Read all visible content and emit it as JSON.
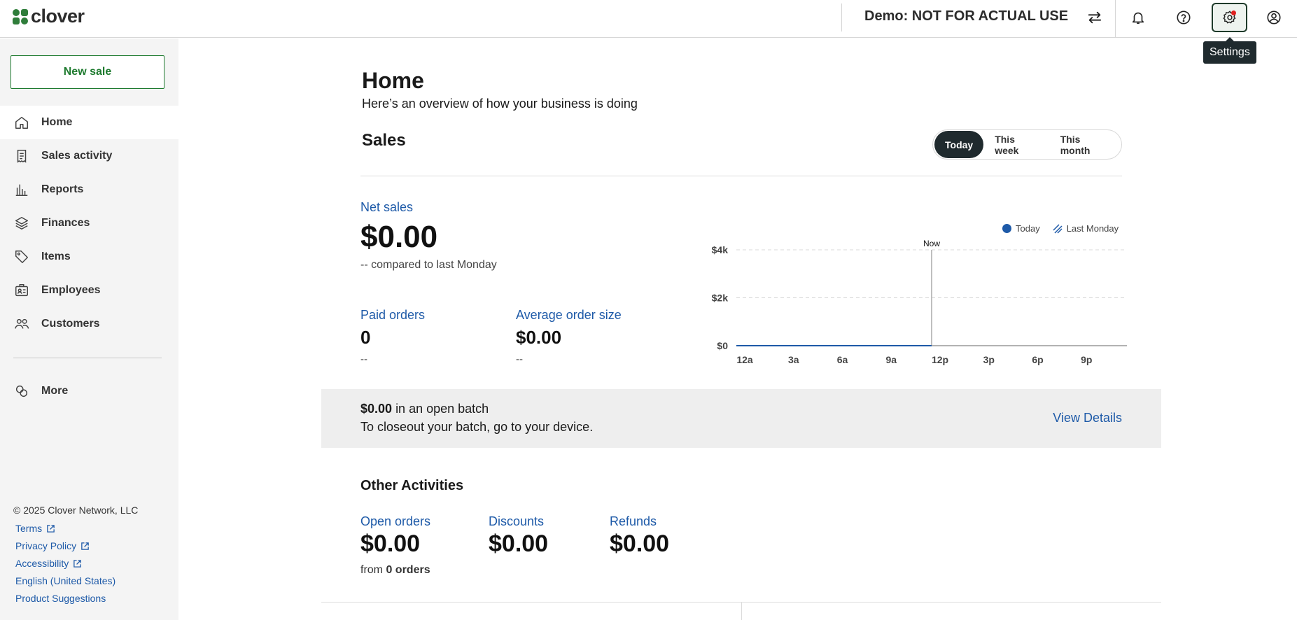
{
  "app": {
    "logo_text": "clover",
    "merchant": "Demo: NOT FOR ACTUAL USE"
  },
  "header_icons": [
    "switch-icon",
    "bell-icon",
    "help-icon",
    "settings-icon",
    "account-icon"
  ],
  "tooltip": "Settings",
  "sidebar": {
    "new_sale": "New sale",
    "items": [
      {
        "label": "Home",
        "icon": "home-icon"
      },
      {
        "label": "Sales activity",
        "icon": "receipt-icon"
      },
      {
        "label": "Reports",
        "icon": "bar-chart-icon"
      },
      {
        "label": "Finances",
        "icon": "layers-icon"
      },
      {
        "label": "Items",
        "icon": "tag-icon"
      },
      {
        "label": "Employees",
        "icon": "id-badge-icon"
      },
      {
        "label": "Customers",
        "icon": "people-icon"
      },
      {
        "label": "More",
        "icon": "more-icon"
      }
    ],
    "footer": {
      "copyright": "© 2025 Clover Network, LLC",
      "links": [
        "Terms",
        "Privacy Policy",
        "Accessibility",
        "English (United States)",
        "Product Suggestions"
      ]
    }
  },
  "main": {
    "title": "Home",
    "subtitle": "Here’s an overview of how your business is doing",
    "sales": {
      "title": "Sales",
      "ranges": [
        "Today",
        "This week",
        "This month"
      ],
      "active_range": "Today",
      "net_sales_label": "Net sales",
      "net_sales_value": "$0.00",
      "compare": "-- compared to last Monday",
      "paid_orders_label": "Paid orders",
      "paid_orders_value": "0",
      "paid_orders_sub": "--",
      "avg_order_label": "Average order size",
      "avg_order_value": "$0.00",
      "avg_order_sub": "--"
    },
    "batch": {
      "amount": "$0.00",
      "text": "in an open batch",
      "line2": "To closeout your batch, go to your device.",
      "link": "View Details"
    },
    "other": {
      "title": "Other Activities",
      "open_orders_label": "Open orders",
      "open_orders_value": "$0.00",
      "open_orders_sub_prefix": "from",
      "open_orders_sub_count": "0 orders",
      "discounts_label": "Discounts",
      "discounts_value": "$0.00",
      "refunds_label": "Refunds",
      "refunds_value": "$0.00"
    }
  },
  "chart_data": {
    "type": "line",
    "x": [
      "12a",
      "3a",
      "6a",
      "9a",
      "12p",
      "3p",
      "6p",
      "9p"
    ],
    "y_ticks": [
      "$0",
      "$2k",
      "$4k"
    ],
    "ylim": [
      0,
      4000
    ],
    "now_label": "Now",
    "now_x": "12p",
    "series": [
      {
        "name": "Today",
        "values": [
          0,
          0,
          0,
          0,
          0
        ]
      },
      {
        "name": "Last Monday",
        "values": []
      }
    ],
    "colors": {
      "today": "#1e5aa8",
      "last_monday": "#1e5aa8",
      "grid": "#d9d9d9",
      "axis": "#999999"
    },
    "legend_position": "top-right",
    "grid": true
  }
}
